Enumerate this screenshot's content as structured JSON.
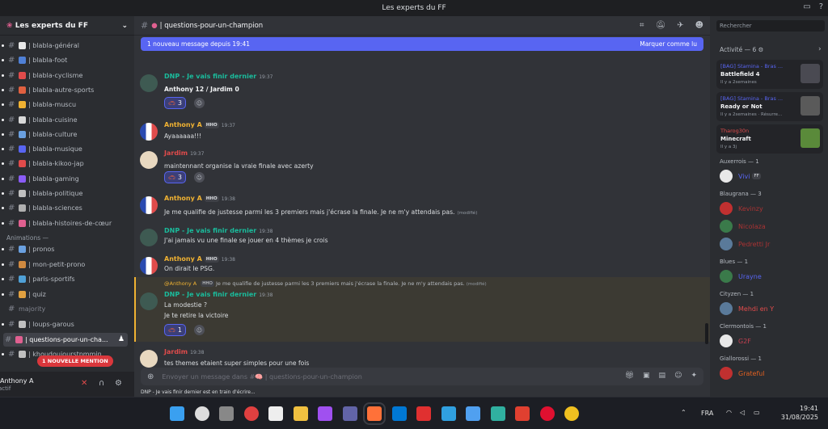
{
  "window": {
    "title": "Les experts du FF"
  },
  "server": {
    "name": "Les experts du FF"
  },
  "channels": [
    {
      "name": "| blabla-général",
      "color": "#e8e8e8"
    },
    {
      "name": "| blabla-foot",
      "color": "#4f80d6"
    },
    {
      "name": "| blabla-cyclisme",
      "color": "#e04b4b"
    },
    {
      "name": "| blabla-autre-sports",
      "color": "#e06040"
    },
    {
      "name": "| blabla-muscu",
      "color": "#f0b232"
    },
    {
      "name": "| blabla-cuisine",
      "color": "#d9d9d9"
    },
    {
      "name": "| blabla-culture",
      "color": "#6aa0e0"
    },
    {
      "name": "| blabla-musique",
      "color": "#5865f2"
    },
    {
      "name": "| blabla-kikoo-jap",
      "color": "#e04b4b"
    },
    {
      "name": "| blabla-gaming",
      "color": "#8a5cf6"
    },
    {
      "name": "| blabla-politique",
      "color": "#c0c0c0"
    },
    {
      "name": "| blabla-sciences",
      "color": "#b0b0b0"
    },
    {
      "name": "| blabla-histoires-de-cœur",
      "color": "#e06090"
    }
  ],
  "category_animations": "Animations —",
  "anim_channels": [
    {
      "name": "| pronos",
      "color": "#6aa0e0"
    },
    {
      "name": "| mon-petit-prono",
      "color": "#d08a40"
    },
    {
      "name": "| paris-sportifs",
      "color": "#4fa0d6"
    },
    {
      "name": "| quiz",
      "color": "#e0a040"
    },
    {
      "name": "majority",
      "color": "#80848e"
    },
    {
      "name": "| loups-garous",
      "color": "#c0c0c0"
    },
    {
      "name": "| questions-pour-un-cha...",
      "color": "#e06090"
    },
    {
      "name": "| khoudoujourstpmmin",
      "color": "#c0c0c0"
    }
  ],
  "mention_pill": "1 NOUVELLE MENTION",
  "user": {
    "name": "Anthony A",
    "status": "actif"
  },
  "header": {
    "channel": "| questions-pour-un-champion"
  },
  "new_message_bar": {
    "text": "1 nouveau message depuis 19:41",
    "action": "Marquer comme lu"
  },
  "messages": [
    {
      "author": "DNP - Je vais finir dernier",
      "color": "#1abc9c",
      "time": "19:37",
      "lines": [
        "Anthony 12 / Jardim 0"
      ],
      "reaction": "3"
    },
    {
      "author": "Anthony A",
      "color": "#f0b232",
      "badge": "HHO",
      "time": "19:37",
      "lines": [
        "Ayaaaaaa!!!"
      ]
    },
    {
      "author": "Jardim",
      "color": "#e04b4b",
      "time": "19:37",
      "lines": [
        "maintennant organise la vraie finale avec azerty"
      ],
      "reaction": "3"
    },
    {
      "author": "Anthony A",
      "color": "#f0b232",
      "badge": "HHO",
      "time": "19:38",
      "lines": [
        "Je me qualifie de justesse parmi les 3 premiers mais j'écrase la finale. Je ne m'y attendais pas."
      ],
      "edited": "(modifié)"
    },
    {
      "author": "DNP - Je vais finir dernier",
      "color": "#1abc9c",
      "time": "19:38",
      "lines": [
        "J'ai jamais vu une finale se jouer en 4 thèmes je crois"
      ]
    },
    {
      "author": "Anthony A",
      "color": "#f0b232",
      "badge": "HHO",
      "time": "19:38",
      "lines": [
        "On dirait le PSG."
      ]
    },
    {
      "author": "DNP - Je vais finir dernier",
      "color": "#1abc9c",
      "time": "19:38",
      "lines": [
        "La modestie ?",
        "Je te retire la victoire"
      ],
      "reaction": "1"
    },
    {
      "author": "Jardim",
      "color": "#e04b4b",
      "time": "19:38",
      "lines": [
        "tes themes etaient super simples pour une fois"
      ]
    }
  ],
  "reply_ref": {
    "author": "@Anthony A",
    "badge": "HHO",
    "text": "Je me qualifie de justesse parmi les 3 premiers mais j'écrase la finale. Je ne m'y attendais pas.",
    "edited": "(modifié)"
  },
  "composer": {
    "placeholder": "Envoyer un message dans #🧠 | questions-pour-un-champion"
  },
  "typing": "DNP - Je vais finir dernier est en train d'écrire...",
  "search": {
    "placeholder": "Rechercher"
  },
  "activity": {
    "title": "Activité — 6",
    "cards": [
      {
        "top": "[BAG] Stamina - Bras ...",
        "game": "Battlefield 4",
        "meta": "Il y a 2semaines",
        "thumb": "#4a4a52"
      },
      {
        "top": "[BAG] Stamina - Bras ...",
        "game": "Ready or Not",
        "meta": "Il y a 2semaines · Résurre...",
        "thumb": "#5a5a5a"
      },
      {
        "top": "Tharog30n",
        "game": "Minecraft",
        "meta": "Il y a 3j",
        "thumb": "#5a8a3a"
      }
    ]
  },
  "roles": [
    {
      "name": "Auxerrois — 1",
      "members": [
        {
          "name": "Vivi",
          "color": "#5865f2",
          "tag": "FF"
        }
      ]
    },
    {
      "name": "Blaugrana — 3",
      "members": [
        {
          "name": "Kevinzy",
          "color": "#a33"
        },
        {
          "name": "Nicolaza",
          "color": "#a33"
        },
        {
          "name": "Pedretti Jr",
          "color": "#a33"
        }
      ]
    },
    {
      "name": "Blues — 1",
      "members": [
        {
          "name": "Urayne",
          "color": "#5865f2"
        }
      ]
    },
    {
      "name": "Cityzen — 1",
      "members": [
        {
          "name": "Mehdi en Y",
          "color": "#e04b4b"
        }
      ]
    },
    {
      "name": "Clermontois — 1",
      "members": [
        {
          "name": "G2F",
          "color": "#c04050"
        }
      ]
    },
    {
      "name": "Giallorossi — 1",
      "members": [
        {
          "name": "Grateful",
          "color": "#e06020"
        }
      ]
    }
  ],
  "taskbar": {
    "lang": "FRA",
    "time": "19:41",
    "date": "31/08/2025"
  }
}
